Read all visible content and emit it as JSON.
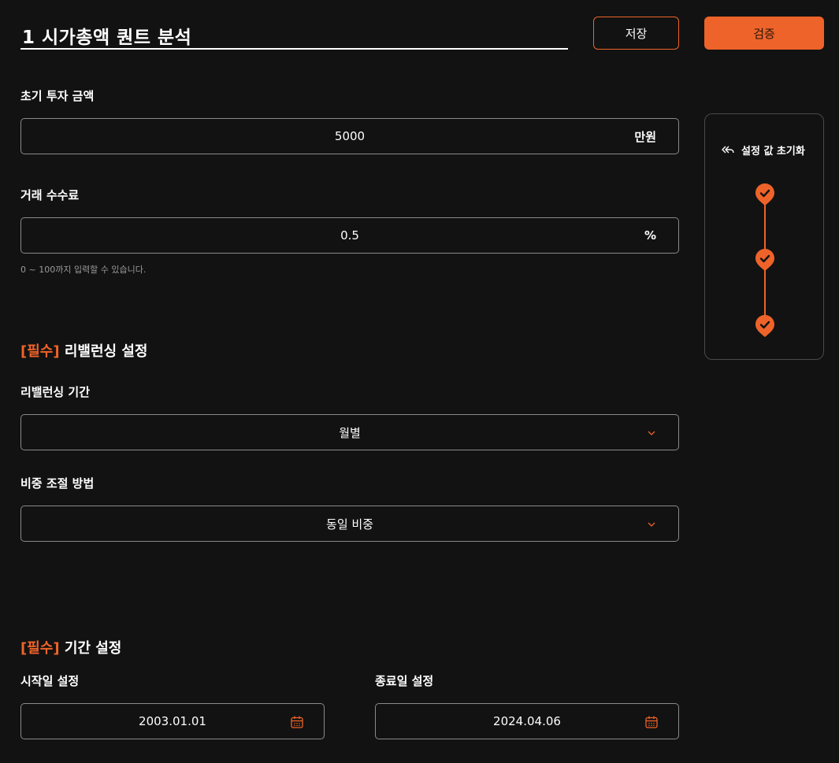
{
  "header": {
    "title": "1 시가총액 퀀트 분석",
    "save_label": "저장",
    "verify_label": "검증"
  },
  "investment": {
    "label": "초기 투자 금액",
    "value": "5000",
    "unit": "만원"
  },
  "fee": {
    "label": "거래 수수료",
    "value": "0.5",
    "unit": "%",
    "hint": "0 ~ 100까지 입력할 수 있습니다."
  },
  "rebalancing": {
    "required_tag": "[필수]",
    "section_title": "리밸런싱 설정",
    "period_label": "리밸런싱 기간",
    "period_value": "월별",
    "weight_label": "비중 조절 방법",
    "weight_value": "동일 비중"
  },
  "period": {
    "required_tag": "[필수]",
    "section_title": "기간 설정",
    "start_label": "시작일 설정",
    "start_value": "2003.01.01",
    "end_label": "종료일 설정",
    "end_value": "2024.04.06"
  },
  "side_panel": {
    "reset_label": "설정 값 초기화",
    "steps_completed": 3
  },
  "colors": {
    "accent": "#ee6329",
    "background": "#121212",
    "border": "#8a8a8a"
  }
}
